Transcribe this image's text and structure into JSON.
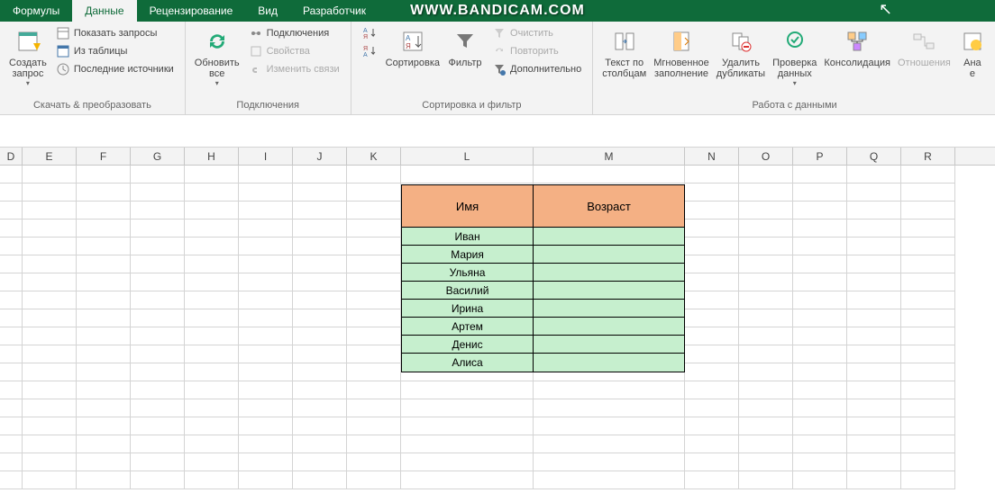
{
  "tabs": {
    "formulas": "Формулы",
    "data": "Данные",
    "review": "Рецензирование",
    "view": "Вид",
    "developer": "Разработчик"
  },
  "watermark": "WWW.BANDICAM.COM",
  "ribbon": {
    "group_get": {
      "newquery": "Создать\nзапрос",
      "showqueries": "Показать запросы",
      "fromtable": "Из таблицы",
      "recentsources": "Последние источники",
      "label": "Скачать & преобразовать"
    },
    "group_conn": {
      "refreshall": "Обновить\nвсе",
      "connections": "Подключения",
      "properties": "Свойства",
      "editlinks": "Изменить связи",
      "label": "Подключения"
    },
    "group_sort": {
      "sortaz": "Я↓А",
      "sort": "Сортировка",
      "filter": "Фильтр",
      "clear": "Очистить",
      "reapply": "Повторить",
      "advanced": "Дополнительно",
      "label": "Сортировка и фильтр"
    },
    "group_tools": {
      "texttocols": "Текст по\nстолбцам",
      "flashfill": "Мгновенное\nзаполнение",
      "removedupes": "Удалить\nдубликаты",
      "validation": "Проверка\nданных",
      "consolidate": "Консолидация",
      "relationships": "Отношения",
      "analysis": "Ана",
      "analysis2": "е",
      "label": "Работа с данными"
    }
  },
  "columns": [
    "D",
    "E",
    "F",
    "G",
    "H",
    "I",
    "J",
    "K",
    "L",
    "M",
    "N",
    "O",
    "P",
    "Q",
    "R"
  ],
  "table": {
    "header": {
      "name": "Имя",
      "age": "Возраст"
    },
    "rows": [
      {
        "name": "Иван",
        "age": ""
      },
      {
        "name": "Мария",
        "age": ""
      },
      {
        "name": "Ульяна",
        "age": ""
      },
      {
        "name": "Василий",
        "age": ""
      },
      {
        "name": "Ирина",
        "age": ""
      },
      {
        "name": "Артем",
        "age": ""
      },
      {
        "name": "Денис",
        "age": ""
      },
      {
        "name": "Алиса",
        "age": ""
      }
    ]
  }
}
